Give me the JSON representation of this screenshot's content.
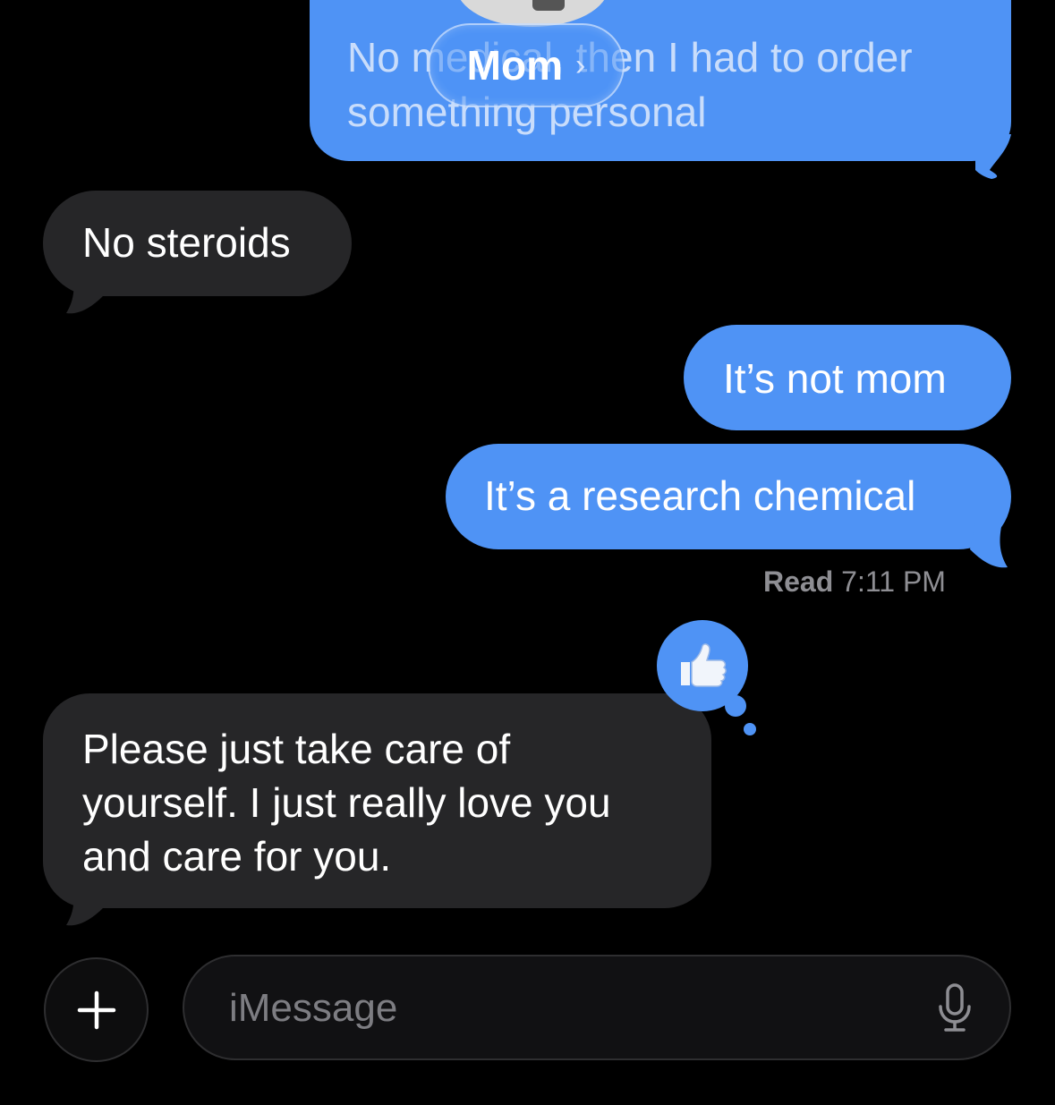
{
  "header": {
    "contact_name": "Mom",
    "chevron": "›"
  },
  "messages": [
    {
      "side": "outgoing",
      "lines": [
        "No medical, then I had to order",
        "something personal"
      ]
    },
    {
      "side": "incoming",
      "text": "No steroids"
    },
    {
      "side": "outgoing",
      "text": "It’s not mom"
    },
    {
      "side": "outgoing",
      "text": "It’s a research chemical"
    },
    {
      "side": "incoming",
      "lines": [
        "Please just take care of",
        "yourself. I just really love you",
        "and care for you."
      ]
    }
  ],
  "receipt": {
    "label": "Read",
    "time": "7:11 PM"
  },
  "reaction": {
    "icon": "thumbs-up-icon"
  },
  "composer": {
    "placeholder": "iMessage",
    "plus_icon": "plus-icon",
    "mic_icon": "microphone-icon"
  },
  "colors": {
    "outgoing": "#4f93f5",
    "incoming": "#262628",
    "background": "#000000"
  }
}
